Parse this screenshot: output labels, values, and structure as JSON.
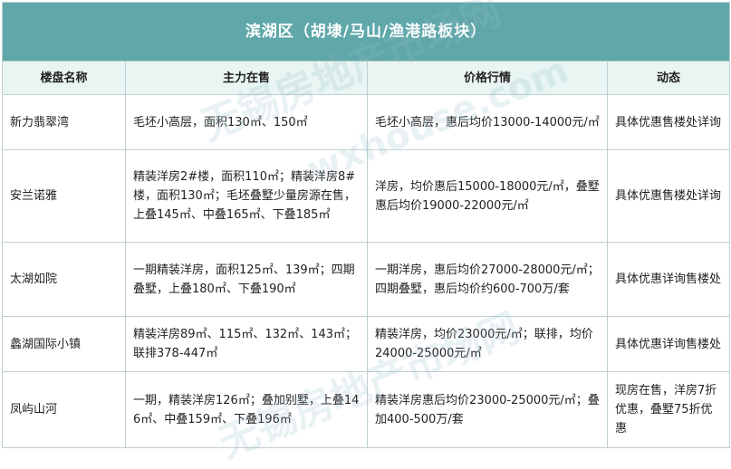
{
  "title": "滨湖区（胡埭/马山/渔港路板块）",
  "columns": [
    "楼盘名称",
    "主力在售",
    "价格行情",
    "动态"
  ],
  "rows": [
    {
      "name": "新力翡翠湾",
      "main": "毛坯小高层，面积130㎡、150㎡",
      "price": "毛坯小高层，惠后均价13000-14000元/㎡",
      "status": "具体优惠售楼处详询"
    },
    {
      "name": "安兰诺雅",
      "main": "精装洋房2#楼，面积110㎡；精装洋房8#楼，面积130㎡；毛坯叠墅少量房源在售，上叠145㎡、中叠165㎡、下叠185㎡",
      "price": "洋房，均价惠后15000-18000元/㎡，叠墅惠后均价19000-22000元/㎡",
      "status": "具体优惠售楼处详询"
    },
    {
      "name": "太湖如院",
      "main": "一期精装洋房，面积125㎡、139㎡；四期叠墅，上叠180㎡、下叠190㎡",
      "price": "一期洋房，惠后均价27000-28000元/㎡；四期叠墅，惠后均价约600-700万/套",
      "status": "具体优惠详询售楼处"
    },
    {
      "name": "蠡湖国际小镇",
      "main": "精装洋房89㎡、115㎡、132㎡、143㎡；联排378-447㎡",
      "price": "精装洋房，均价23000元/㎡；联排，均价24000-25000元/㎡",
      "status": "具体优惠详询售楼处"
    },
    {
      "name": "凤屿山河",
      "main": "一期，精装洋房126㎡；叠加别墅，上叠146㎡、中叠159㎡、下叠196㎡",
      "price": "精装洋房惠后均价23000-25000元/㎡；叠加400-500万/套",
      "status": "现房在售，洋房7折优惠，叠墅75折优惠"
    }
  ],
  "watermark": {
    "text1": "无锡房地产市场网",
    "text2": "wxhouse.com"
  }
}
